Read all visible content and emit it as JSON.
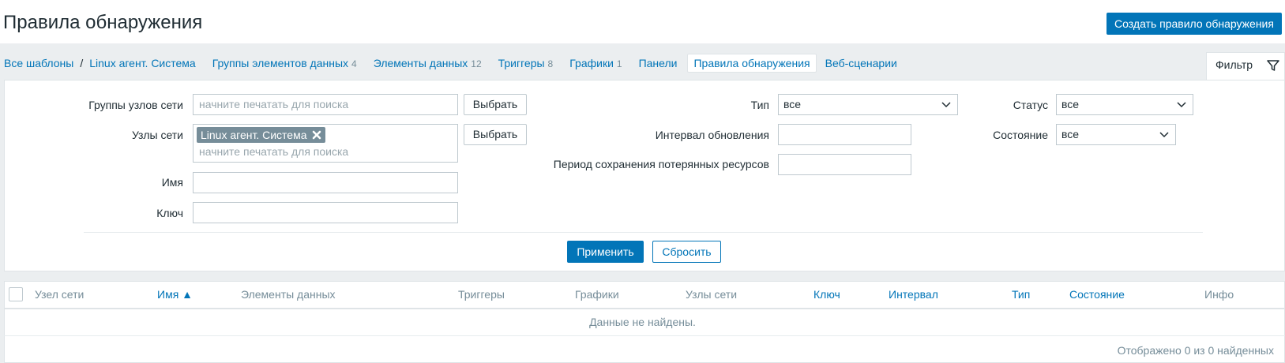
{
  "header": {
    "title": "Правила обнаружения",
    "create_button": "Создать правило обнаружения"
  },
  "breadcrumb": {
    "all_templates": "Все шаблоны",
    "separator": "/",
    "template": "Linux агент. Система"
  },
  "tabs": [
    {
      "label": "Группы элементов данных",
      "count": "4"
    },
    {
      "label": "Элементы данных",
      "count": "12"
    },
    {
      "label": "Триггеры",
      "count": "8"
    },
    {
      "label": "Графики",
      "count": "1"
    },
    {
      "label": "Панели",
      "count": ""
    },
    {
      "label": "Правила обнаружения",
      "count": "",
      "active": true
    },
    {
      "label": "Веб-сценарии",
      "count": ""
    }
  ],
  "filter": {
    "tab_label": "Фильтр",
    "host_groups_label": "Группы узлов сети",
    "host_groups_placeholder": "начните печатать для поиска",
    "select_button": "Выбрать",
    "hosts_label": "Узлы сети",
    "hosts_chip": "Linux агент. Система",
    "hosts_placeholder": "начните печатать для поиска",
    "name_label": "Имя",
    "name_value": "",
    "key_label": "Ключ",
    "key_value": "",
    "type_label": "Тип",
    "type_value": "все",
    "interval_label": "Интервал обновления",
    "interval_value": "",
    "lost_period_label": "Период сохранения потерянных ресурсов",
    "lost_period_value": "",
    "status_label": "Статус",
    "status_value": "все",
    "state_label": "Состояние",
    "state_value": "все",
    "apply_button": "Применить",
    "reset_button": "Сбросить"
  },
  "table": {
    "columns": [
      "Узел сети",
      "Имя ▲",
      "Элементы данных",
      "Триггеры",
      "Графики",
      "Узлы сети",
      "Ключ",
      "Интервал",
      "Тип",
      "Состояние",
      "Инфо"
    ],
    "no_data": "Данные не найдены.",
    "footer": "Отображено 0 из 0 найденных"
  },
  "colors": {
    "accent": "#0275b8",
    "muted": "#768d99",
    "background": "#ebeef0"
  }
}
